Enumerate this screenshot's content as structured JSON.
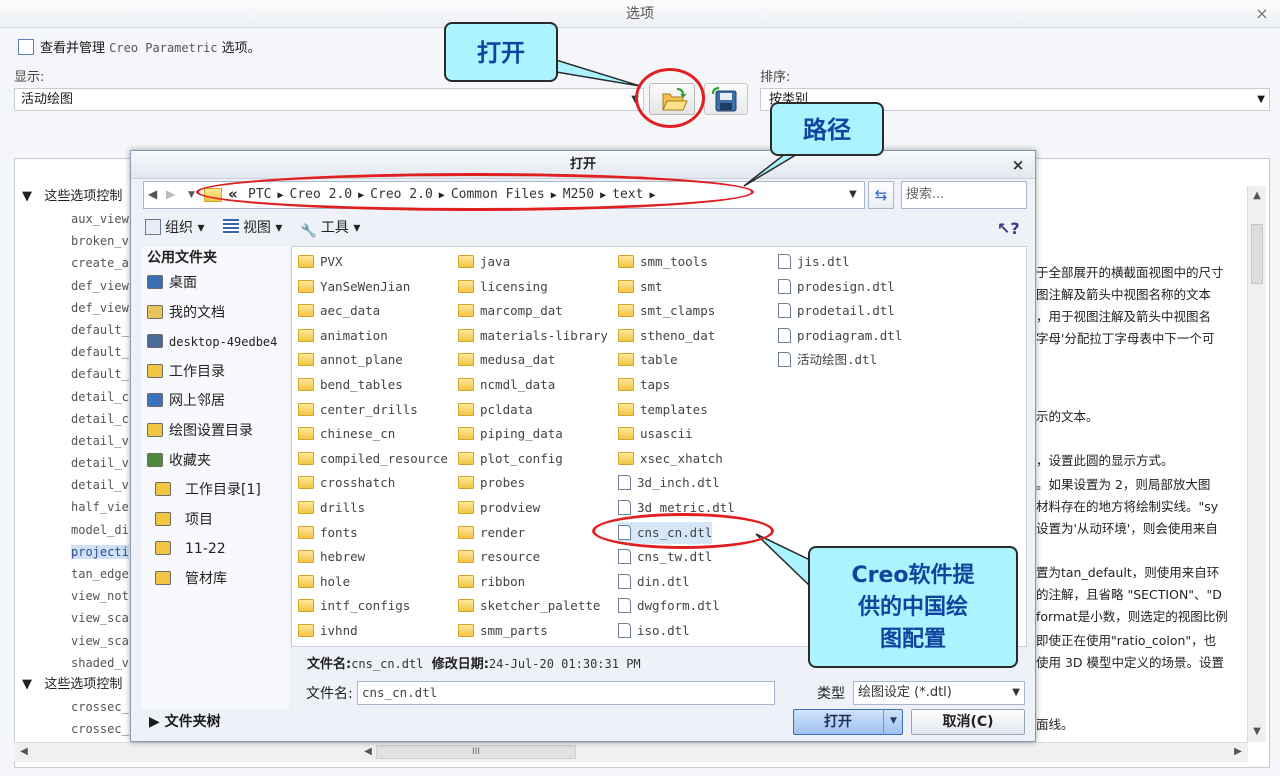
{
  "options_window": {
    "title": "选项",
    "close": "×",
    "header_prefix": "查看并管理",
    "header_product": "Creo Parametric",
    "header_suffix": "选项。",
    "display_label": "显示:",
    "display_value": "活动绘图",
    "sort_label": "排序:",
    "sort_value": "按类别",
    "tree": {
      "group1": "这些选项控制",
      "items": [
        "aux_view",
        "broken_v",
        "create_a",
        "def_view",
        "def_view",
        "default_",
        "default_",
        "default_",
        "detail_c",
        "detail_c",
        "detail_v",
        "detail_v",
        "detail_v",
        "half_vie",
        "model_di",
        "projecti",
        "tan_edge",
        "view_not",
        "view_sca",
        "view_sca",
        "shaded_v"
      ],
      "selected_index": 15,
      "group2": "这些选项控制",
      "items2": [
        "crossec_",
        "crossec_"
      ]
    },
    "descriptions": [
      "于全部展开的横截面视图中的尺寸",
      "图注解及箭头中视图名称的文本",
      "，用于视图注解及箭头中视图名",
      "字母'分配拉丁字母表中下一个可",
      "示的文本。",
      "，设置此圆的显示方式。",
      "。如果设置为 2，则局部放大图",
      "材料存在的地方将绘制实线。\"sy",
      "设置为'从动环境'，则会使用来自",
      "置为tan_default，则使用来自环",
      "的注解，且省略 \"SECTION\"、\"D",
      "format是小数，则选定的视图比例",
      "即使正在使用\"ratio_colon\"，也",
      "使用 3D 模型中定义的场景。设置",
      "面线。"
    ],
    "hscroll_grip": "III"
  },
  "open_dialog": {
    "title": "打开",
    "close": "×",
    "address": {
      "prefix": "«",
      "crumbs": [
        "PTC",
        "Creo 2.0",
        "Creo 2.0",
        "Common Files",
        "M250",
        "text"
      ]
    },
    "search_placeholder": "搜索...",
    "toolbar": {
      "organize": "组织",
      "views": "视图",
      "tools": "工具"
    },
    "sidebar": {
      "heading": "公用文件夹",
      "items": [
        "桌面",
        "我的文档",
        "desktop-49edbe4",
        "工作目录",
        "网上邻居",
        "绘图设置目录",
        "收藏夹",
        "工作目录[1]",
        "项目",
        "11-22",
        "管材库"
      ],
      "footer": "文件夹树"
    },
    "files": {
      "col1": [
        "PVX",
        "YanSeWenJian",
        "aec_data",
        "animation",
        "annot_plane",
        "bend_tables",
        "center_drills",
        "chinese_cn",
        "compiled_resource",
        "crosshatch",
        "drills",
        "fonts",
        "hebrew",
        "hole",
        "intf_configs",
        "ivhnd"
      ],
      "col2": [
        "java",
        "licensing",
        "marcomp_dat",
        "materials-library",
        "medusa_dat",
        "ncmdl_data",
        "pcldata",
        "piping_data",
        "plot_config",
        "probes",
        "prodview",
        "render",
        "resource",
        "ribbon",
        "sketcher_palette",
        "smm_parts"
      ],
      "col3": [
        "smm_tools",
        "smt",
        "smt_clamps",
        "stheno_dat",
        "table",
        "taps",
        "templates",
        "usascii",
        "xsec_xhatch",
        "3d_inch.dtl",
        "3d_metric.dtl",
        "cns_cn.dtl",
        "cns_tw.dtl",
        "din.dtl",
        "dwgform.dtl",
        "iso.dtl"
      ],
      "col3_folder_count": 9,
      "col4": [
        "jis.dtl",
        "prodesign.dtl",
        "prodetail.dtl",
        "prodiagram.dtl",
        "活动绘图.dtl"
      ],
      "selected": "cns_cn.dtl"
    },
    "info": {
      "name_label": "文件名:",
      "name_value": "cns_cn.dtl",
      "date_label": "修改日期:",
      "date_value": "24-Jul-20 01:30:31 PM"
    },
    "filename_label": "文件名:",
    "filename_value": "cns_cn.dtl",
    "type_label": "类型",
    "type_value": "绘图设定 (*.dtl)",
    "open_button": "打开",
    "cancel_button": "取消(C)"
  },
  "callouts": {
    "open": "打开",
    "path": "路径",
    "china_line1": "Creo软件提",
    "china_line2": "供的中国绘",
    "china_line3": "图配置"
  },
  "colors": {
    "callout_fill": "#aaf3ff",
    "callout_text": "#11449f",
    "ring": "#e02020",
    "selection": "#d7e7fa"
  }
}
